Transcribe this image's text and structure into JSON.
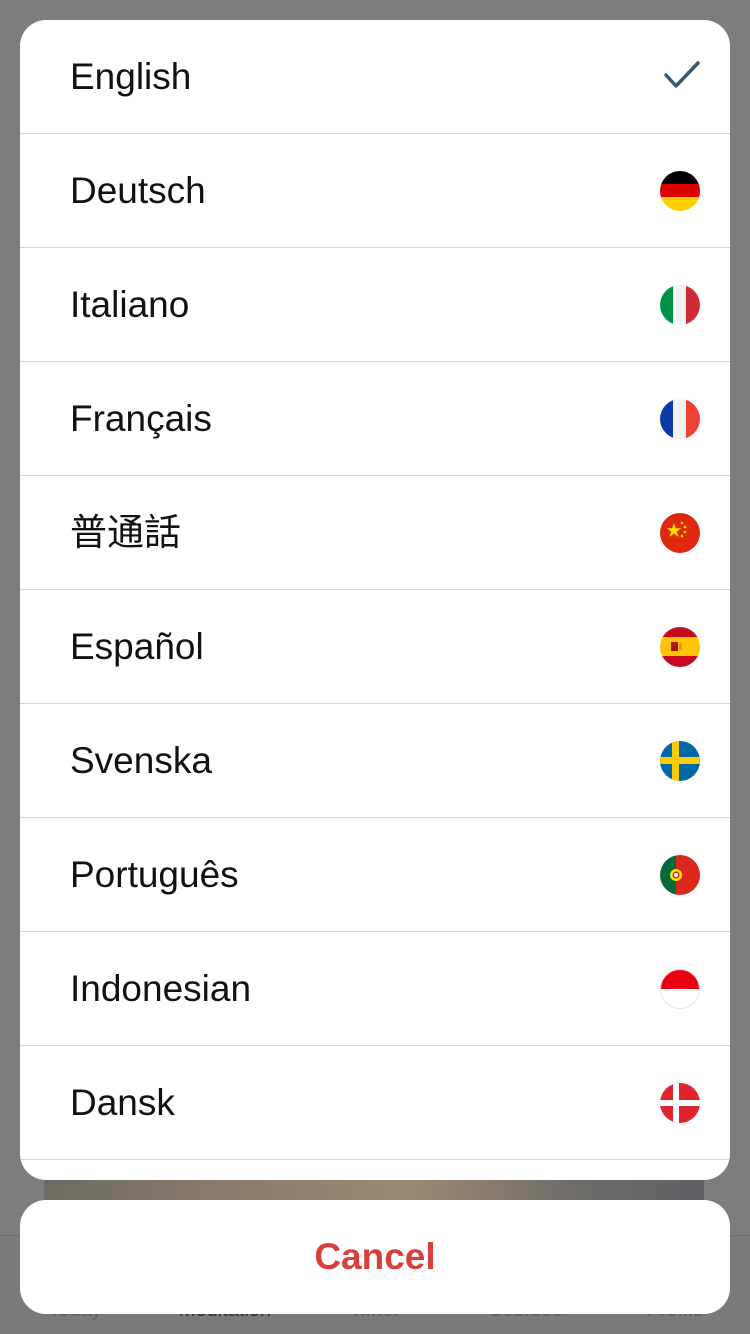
{
  "background": {
    "tabs": [
      {
        "label": "Today"
      },
      {
        "label": "Meditation"
      },
      {
        "label": "Timer"
      },
      {
        "label": "Courses"
      },
      {
        "label": "Profile"
      }
    ]
  },
  "sheet": {
    "languages": [
      {
        "label": "English",
        "selected": true,
        "icon": "checkmark-icon"
      },
      {
        "label": "Deutsch",
        "selected": false,
        "icon": "flag-germany-icon"
      },
      {
        "label": "Italiano",
        "selected": false,
        "icon": "flag-italy-icon"
      },
      {
        "label": "Français",
        "selected": false,
        "icon": "flag-france-icon"
      },
      {
        "label": "普通話",
        "selected": false,
        "icon": "flag-china-icon"
      },
      {
        "label": "Español",
        "selected": false,
        "icon": "flag-spain-icon"
      },
      {
        "label": "Svenska",
        "selected": false,
        "icon": "flag-sweden-icon"
      },
      {
        "label": "Português",
        "selected": false,
        "icon": "flag-portugal-icon"
      },
      {
        "label": "Indonesian",
        "selected": false,
        "icon": "flag-indonesia-icon"
      },
      {
        "label": "Dansk",
        "selected": false,
        "icon": "flag-denmark-icon"
      }
    ],
    "cancel_label": "Cancel"
  },
  "colors": {
    "overlay": "#7d7d7d",
    "check": "#2f5d6b",
    "cancel": "#d9403d"
  }
}
